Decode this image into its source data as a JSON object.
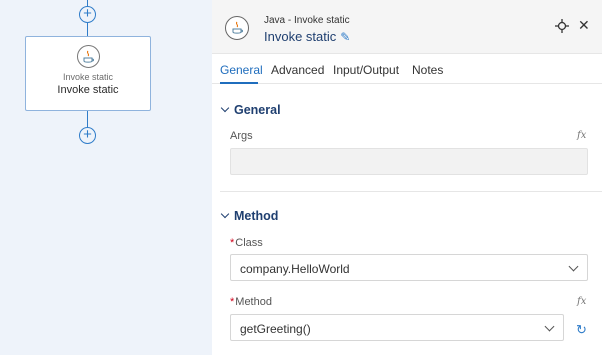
{
  "canvas": {
    "node": {
      "subtitle": "Invoke static",
      "title": "Invoke static"
    },
    "plus_symbol": "+"
  },
  "panel": {
    "header": {
      "subtitle": "Java - Invoke static",
      "title": "Invoke static"
    },
    "tabs": [
      {
        "label": "General",
        "active": true
      },
      {
        "label": "Advanced",
        "active": false
      },
      {
        "label": "Input/Output",
        "active": false
      },
      {
        "label": "Notes",
        "active": false
      }
    ],
    "general_section": {
      "title": "General",
      "args": {
        "label": "Args",
        "value": "",
        "fx": "fx"
      }
    },
    "method_section": {
      "title": "Method",
      "class_field": {
        "required": "*",
        "label": "Class",
        "value": "company.HelloWorld"
      },
      "method_field": {
        "required": "*",
        "label": "Method",
        "value": "getGreeting()",
        "fx": "fx"
      }
    }
  },
  "colors": {
    "accent": "#1f6dbd",
    "canvas_bg": "#eef3fa",
    "required": "#d0021b"
  },
  "icons": [
    "plus-icon",
    "java-icon",
    "edit-icon",
    "pin-icon",
    "close-icon",
    "chevron-down-icon",
    "fx-icon",
    "refresh-icon"
  ]
}
